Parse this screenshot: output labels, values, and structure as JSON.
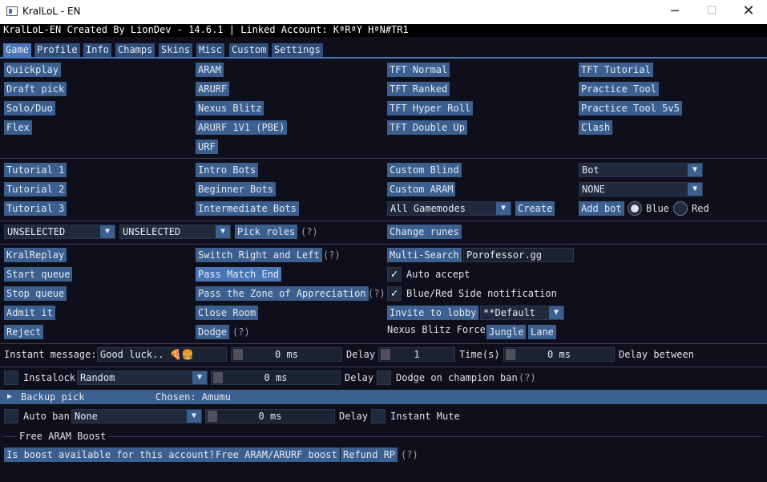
{
  "window": {
    "title": "KralLoL - EN",
    "minimize": "─",
    "maximize": "☐",
    "close": "✕"
  },
  "header": {
    "text": "KralLoL-EN Created By LionDev - 14.6.1 | Linked Account: KªRªY HªN#TR1"
  },
  "tabs": [
    "Game",
    "Profile",
    "Info",
    "Champs",
    "Skins",
    "Misc",
    "Custom",
    "Settings"
  ],
  "queues": {
    "col1": [
      "Quickplay",
      "Draft pick",
      "Solo/Duo",
      "Flex"
    ],
    "col2": [
      "ARAM",
      "ARURF",
      "Nexus Blitz",
      "ARURF 1V1 (PBE)",
      "URF"
    ],
    "col3": [
      "TFT Normal",
      "TFT Ranked",
      "TFT Hyper Roll",
      "TFT Double Up"
    ],
    "col4": [
      "TFT Tutorial",
      "Practice Tool",
      "Practice Tool 5v5",
      "Clash"
    ]
  },
  "tutorials": [
    "Tutorial 1",
    "Tutorial 2",
    "Tutorial 3"
  ],
  "bots": [
    "Intro Bots",
    "Beginner Bots",
    "Intermediate Bots"
  ],
  "custom": {
    "blind": "Custom Blind",
    "aram": "Custom ARAM",
    "gamemode": "All Gamemodes",
    "create": "Create",
    "bot_select": "Bot",
    "difficulty": "NONE",
    "add_bot": "Add bot",
    "blue": "Blue",
    "red": "Red"
  },
  "roles": {
    "role1": "UNSELECTED",
    "role2": "UNSELECTED",
    "pick_roles": "Pick roles",
    "hint": "(?)",
    "change_runes": "Change runes"
  },
  "actions": {
    "kralreplay": "KralReplay",
    "start_queue": "Start queue",
    "stop_queue": "Stop queue",
    "admit_it": "Admit it",
    "reject": "Reject",
    "switch": "Switch Right and Left",
    "switch_hint": "(?)",
    "pass_match_end": "Pass Match End",
    "pass_zone": "Pass the Zone of Appreciation",
    "pass_zone_hint": "(?)",
    "close_room": "Close Room",
    "dodge": "Dodge",
    "dodge_hint": "(?)",
    "multi_search": "Multi-Search",
    "multi_search_value": "Porofessor.gg",
    "auto_accept": "Auto accept",
    "side_notification": "Blue/Red Side notification",
    "invite": "Invite to lobby",
    "invite_value": "**Default",
    "nexus_force": "Nexus Blitz Force",
    "jungle": "Jungle",
    "lane": "Lane"
  },
  "instant_message": {
    "label": "Instant message:",
    "value": "Good luck.. 🍕🍔",
    "delay1": "0 ms",
    "delay_label": "Delay",
    "times": "1",
    "times_label": "Time(s)",
    "delay2": "0 ms",
    "delay_between": "Delay between"
  },
  "instalock": {
    "label": "Instalock",
    "champion": "Random",
    "delay": "0 ms",
    "delay_label": "Delay",
    "dodge_ban": "Dodge on champion ban",
    "hint": "(?)"
  },
  "backup_pick": {
    "arrow": "▶",
    "label": "Backup pick",
    "chosen": "Chosen: Amumu"
  },
  "auto_ban": {
    "label": "Auto ban",
    "champion": "None",
    "delay": "0 ms",
    "delay_label": "Delay",
    "instant_mute": "Instant Mute"
  },
  "free_aram": {
    "heading": "Free ARAM Boost",
    "check": "Is boost available for this account?",
    "boost": "Free ARAM/ARURF boost",
    "refund": "Refund RP",
    "hint": "(?)"
  },
  "colors": {
    "bg": "#0f0f1c",
    "button": "#3b5f8f",
    "tab_active": "#4a76b8"
  }
}
